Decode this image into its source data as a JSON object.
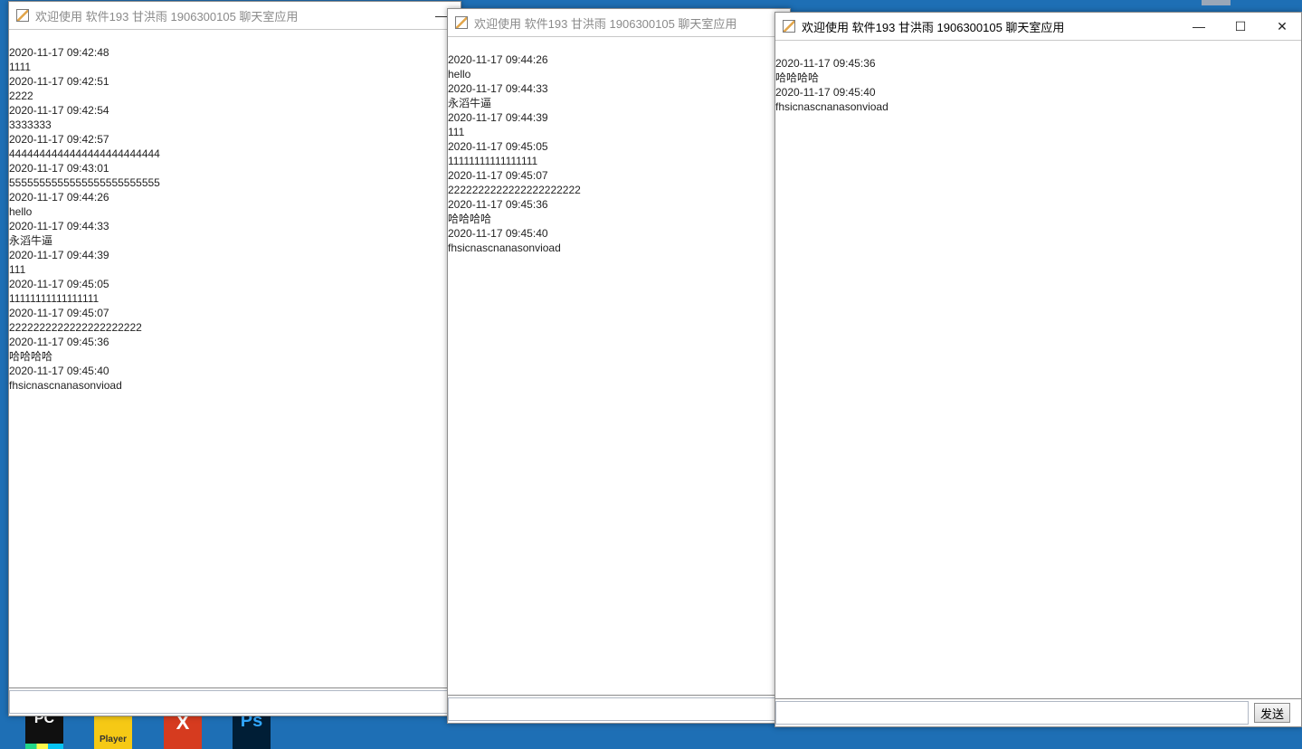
{
  "desktop": {
    "icons": [
      "PC",
      "Player",
      "X",
      "Ps"
    ]
  },
  "windows": [
    {
      "title": "欢迎使用 软件193 甘洪雨 1906300105 聊天室应用",
      "minimize_glyph": "—",
      "messages": [
        "2020-11-17 09:42:48",
        "1111",
        "2020-11-17 09:42:51",
        "2222",
        "2020-11-17 09:42:54",
        "3333333",
        "2020-11-17 09:42:57",
        "4444444444444444444444444",
        "2020-11-17 09:43:01",
        "5555555555555555555555555",
        "2020-11-17 09:44:26",
        "hello",
        "2020-11-17 09:44:33",
        "永滔牛逼",
        "2020-11-17 09:44:39",
        "111",
        "2020-11-17 09:45:05",
        "11111111111111111",
        "2020-11-17 09:45:07",
        "2222222222222222222222",
        "2020-11-17 09:45:36",
        "哈哈哈哈",
        "2020-11-17 09:45:40",
        "fhsicnascnanasonvioad"
      ]
    },
    {
      "title": "欢迎使用 软件193 甘洪雨 1906300105 聊天室应用",
      "messages": [
        "2020-11-17 09:44:26",
        "hello",
        "2020-11-17 09:44:33",
        "永滔牛逼",
        "2020-11-17 09:44:39",
        "111",
        "2020-11-17 09:45:05",
        "11111111111111111",
        "2020-11-17 09:45:07",
        "2222222222222222222222",
        "2020-11-17 09:45:36",
        "哈哈哈哈",
        "2020-11-17 09:45:40",
        "fhsicnascnanasonvioad"
      ]
    },
    {
      "title": "欢迎使用 软件193 甘洪雨 1906300105 聊天室应用",
      "minimize_glyph": "—",
      "maximize_glyph": "☐",
      "close_glyph": "✕",
      "send_label": "发送",
      "messages": [
        "2020-11-17 09:45:36",
        "哈哈哈哈",
        "2020-11-17 09:45:40",
        "fhsicnascnanasonvioad"
      ]
    }
  ]
}
